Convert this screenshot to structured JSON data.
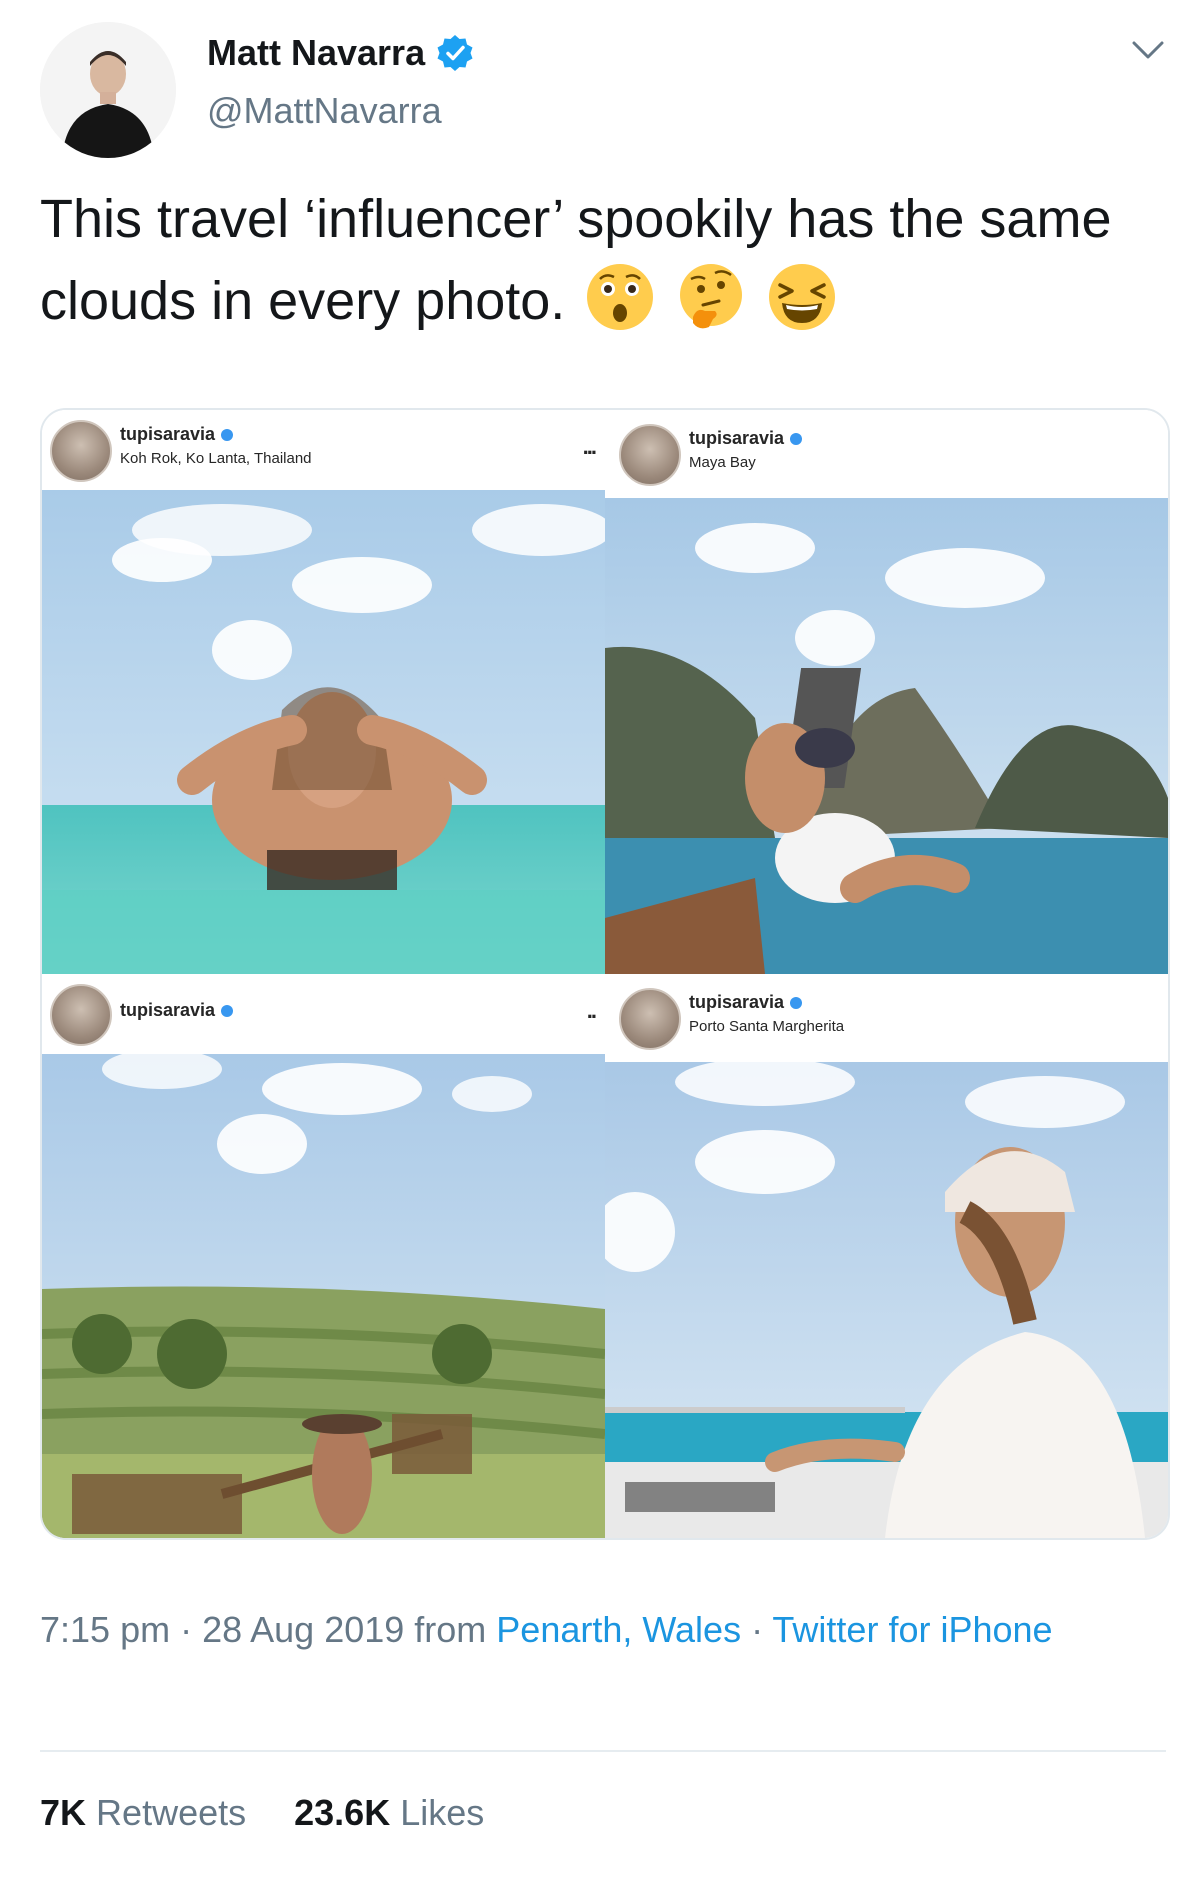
{
  "author": {
    "display_name": "Matt Navarra",
    "handle": "@MattNavarra",
    "verified": true
  },
  "tweet": {
    "text": "This travel ‘influencer’ spookily has the same clouds in every photo.",
    "emojis": [
      "astonished-face",
      "thinking-face",
      "laughing-face"
    ]
  },
  "media": {
    "posts": [
      {
        "username": "tupisaravia",
        "location": "Koh Rok, Ko Lanta, Thailand",
        "more": "...",
        "scene": "woman smiling in turquoise sea under cloudy blue sky"
      },
      {
        "username": "tupisaravia",
        "location": "Maya Bay",
        "more": "",
        "scene": "woman sitting on boat near limestone cliffs"
      },
      {
        "username": "tupisaravia",
        "location": "",
        "more": "..",
        "scene": "woman carrying baskets in rice terraces"
      },
      {
        "username": "tupisaravia",
        "location": "Porto Santa Margherita",
        "more": "",
        "scene": "woman in white shirt and headscarf on boat"
      }
    ]
  },
  "meta": {
    "time": "7:15 pm",
    "sep1": " · ",
    "date": "28 Aug 2019",
    "from": " from ",
    "place": "Penarth, Wales",
    "sep2": " · ",
    "client": "Twitter for iPhone"
  },
  "stats": {
    "retweets_count": "7K",
    "retweets_label": "Retweets",
    "likes_count": "23.6K",
    "likes_label": "Likes"
  },
  "colors": {
    "link": "#1b95e0",
    "verified": "#1da1f2",
    "muted": "#657786"
  }
}
